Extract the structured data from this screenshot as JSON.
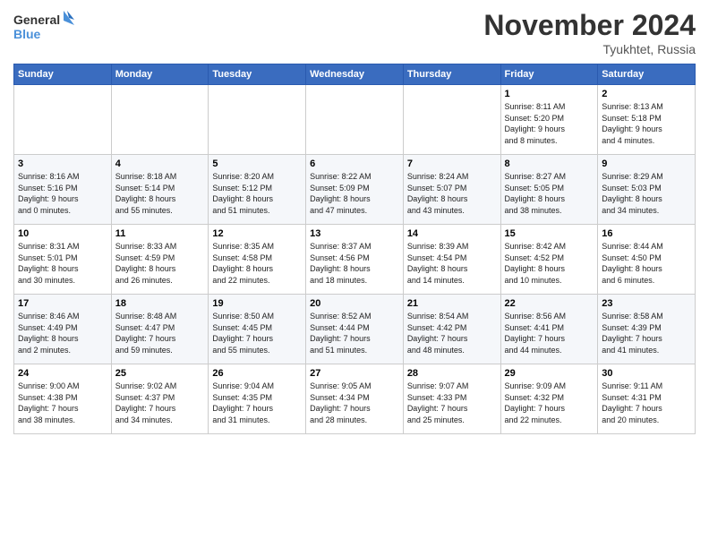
{
  "header": {
    "logo_line1": "General",
    "logo_line2": "Blue",
    "month_title": "November 2024",
    "location": "Tyukhtet, Russia"
  },
  "weekdays": [
    "Sunday",
    "Monday",
    "Tuesday",
    "Wednesday",
    "Thursday",
    "Friday",
    "Saturday"
  ],
  "weeks": [
    [
      {
        "day": "",
        "info": ""
      },
      {
        "day": "",
        "info": ""
      },
      {
        "day": "",
        "info": ""
      },
      {
        "day": "",
        "info": ""
      },
      {
        "day": "",
        "info": ""
      },
      {
        "day": "1",
        "info": "Sunrise: 8:11 AM\nSunset: 5:20 PM\nDaylight: 9 hours\nand 8 minutes."
      },
      {
        "day": "2",
        "info": "Sunrise: 8:13 AM\nSunset: 5:18 PM\nDaylight: 9 hours\nand 4 minutes."
      }
    ],
    [
      {
        "day": "3",
        "info": "Sunrise: 8:16 AM\nSunset: 5:16 PM\nDaylight: 9 hours\nand 0 minutes."
      },
      {
        "day": "4",
        "info": "Sunrise: 8:18 AM\nSunset: 5:14 PM\nDaylight: 8 hours\nand 55 minutes."
      },
      {
        "day": "5",
        "info": "Sunrise: 8:20 AM\nSunset: 5:12 PM\nDaylight: 8 hours\nand 51 minutes."
      },
      {
        "day": "6",
        "info": "Sunrise: 8:22 AM\nSunset: 5:09 PM\nDaylight: 8 hours\nand 47 minutes."
      },
      {
        "day": "7",
        "info": "Sunrise: 8:24 AM\nSunset: 5:07 PM\nDaylight: 8 hours\nand 43 minutes."
      },
      {
        "day": "8",
        "info": "Sunrise: 8:27 AM\nSunset: 5:05 PM\nDaylight: 8 hours\nand 38 minutes."
      },
      {
        "day": "9",
        "info": "Sunrise: 8:29 AM\nSunset: 5:03 PM\nDaylight: 8 hours\nand 34 minutes."
      }
    ],
    [
      {
        "day": "10",
        "info": "Sunrise: 8:31 AM\nSunset: 5:01 PM\nDaylight: 8 hours\nand 30 minutes."
      },
      {
        "day": "11",
        "info": "Sunrise: 8:33 AM\nSunset: 4:59 PM\nDaylight: 8 hours\nand 26 minutes."
      },
      {
        "day": "12",
        "info": "Sunrise: 8:35 AM\nSunset: 4:58 PM\nDaylight: 8 hours\nand 22 minutes."
      },
      {
        "day": "13",
        "info": "Sunrise: 8:37 AM\nSunset: 4:56 PM\nDaylight: 8 hours\nand 18 minutes."
      },
      {
        "day": "14",
        "info": "Sunrise: 8:39 AM\nSunset: 4:54 PM\nDaylight: 8 hours\nand 14 minutes."
      },
      {
        "day": "15",
        "info": "Sunrise: 8:42 AM\nSunset: 4:52 PM\nDaylight: 8 hours\nand 10 minutes."
      },
      {
        "day": "16",
        "info": "Sunrise: 8:44 AM\nSunset: 4:50 PM\nDaylight: 8 hours\nand 6 minutes."
      }
    ],
    [
      {
        "day": "17",
        "info": "Sunrise: 8:46 AM\nSunset: 4:49 PM\nDaylight: 8 hours\nand 2 minutes."
      },
      {
        "day": "18",
        "info": "Sunrise: 8:48 AM\nSunset: 4:47 PM\nDaylight: 7 hours\nand 59 minutes."
      },
      {
        "day": "19",
        "info": "Sunrise: 8:50 AM\nSunset: 4:45 PM\nDaylight: 7 hours\nand 55 minutes."
      },
      {
        "day": "20",
        "info": "Sunrise: 8:52 AM\nSunset: 4:44 PM\nDaylight: 7 hours\nand 51 minutes."
      },
      {
        "day": "21",
        "info": "Sunrise: 8:54 AM\nSunset: 4:42 PM\nDaylight: 7 hours\nand 48 minutes."
      },
      {
        "day": "22",
        "info": "Sunrise: 8:56 AM\nSunset: 4:41 PM\nDaylight: 7 hours\nand 44 minutes."
      },
      {
        "day": "23",
        "info": "Sunrise: 8:58 AM\nSunset: 4:39 PM\nDaylight: 7 hours\nand 41 minutes."
      }
    ],
    [
      {
        "day": "24",
        "info": "Sunrise: 9:00 AM\nSunset: 4:38 PM\nDaylight: 7 hours\nand 38 minutes."
      },
      {
        "day": "25",
        "info": "Sunrise: 9:02 AM\nSunset: 4:37 PM\nDaylight: 7 hours\nand 34 minutes."
      },
      {
        "day": "26",
        "info": "Sunrise: 9:04 AM\nSunset: 4:35 PM\nDaylight: 7 hours\nand 31 minutes."
      },
      {
        "day": "27",
        "info": "Sunrise: 9:05 AM\nSunset: 4:34 PM\nDaylight: 7 hours\nand 28 minutes."
      },
      {
        "day": "28",
        "info": "Sunrise: 9:07 AM\nSunset: 4:33 PM\nDaylight: 7 hours\nand 25 minutes."
      },
      {
        "day": "29",
        "info": "Sunrise: 9:09 AM\nSunset: 4:32 PM\nDaylight: 7 hours\nand 22 minutes."
      },
      {
        "day": "30",
        "info": "Sunrise: 9:11 AM\nSunset: 4:31 PM\nDaylight: 7 hours\nand 20 minutes."
      }
    ]
  ]
}
